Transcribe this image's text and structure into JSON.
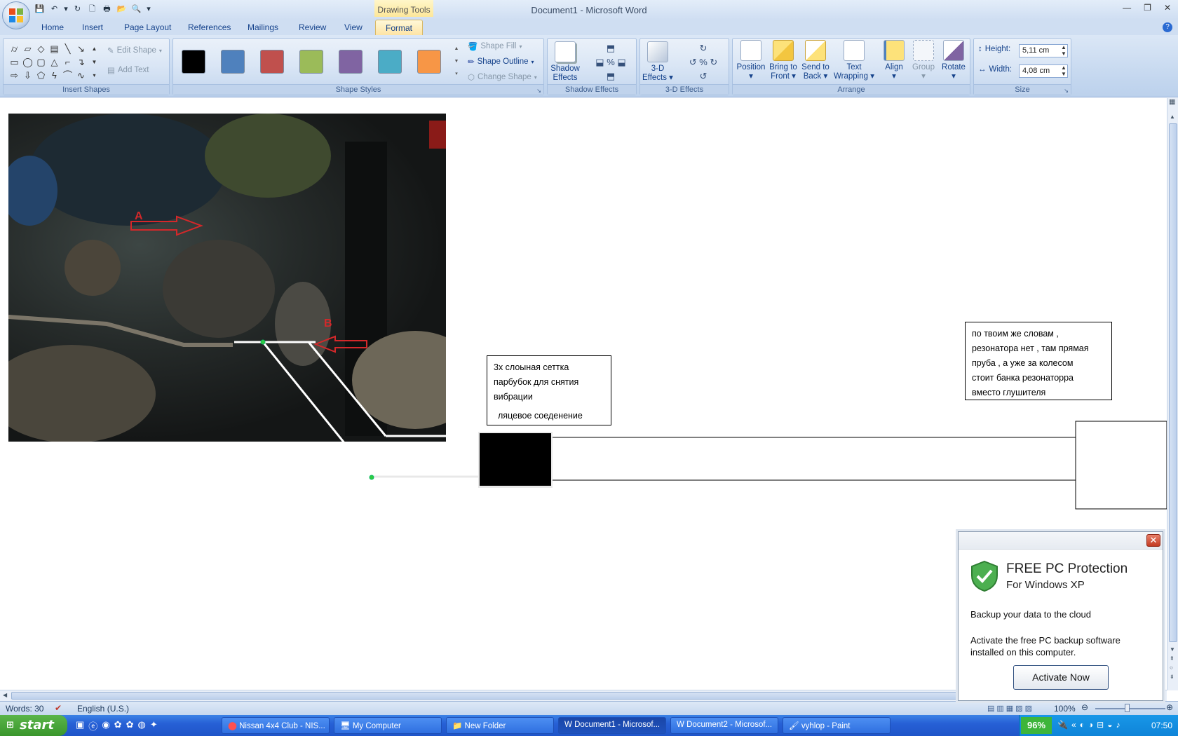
{
  "window": {
    "title": "Document1 - Microsoft Word",
    "contextual_tab_group": "Drawing Tools"
  },
  "tabs": [
    "Home",
    "Insert",
    "Page Layout",
    "References",
    "Mailings",
    "Review",
    "View",
    "Format"
  ],
  "active_tab": "Format",
  "ribbon": {
    "insert_shapes": {
      "label": "Insert Shapes",
      "edit_shape": "Edit Shape",
      "add_text": "Add Text"
    },
    "shape_styles": {
      "label": "Shape Styles",
      "swatches": [
        "#000000",
        "#4f81bd",
        "#c0504d",
        "#9bbb59",
        "#8064a2",
        "#4bacc6",
        "#f79646"
      ],
      "shape_fill": "Shape Fill",
      "shape_outline": "Shape Outline",
      "change_shape": "Change Shape"
    },
    "shadow_effects": {
      "label": "Shadow Effects",
      "button_line1": "Shadow",
      "button_line2": "Effects"
    },
    "effects_3d": {
      "label": "3-D Effects",
      "button_line1": "3-D",
      "button_line2": "Effects"
    },
    "arrange": {
      "label": "Arrange",
      "position": "Position",
      "bring_front_1": "Bring to",
      "bring_front_2": "Front",
      "send_back_1": "Send to",
      "send_back_2": "Back",
      "wrap_1": "Text",
      "wrap_2": "Wrapping",
      "align": "Align",
      "group": "Group",
      "rotate": "Rotate"
    },
    "size": {
      "label": "Size",
      "height_label": "Height:",
      "height_value": "5,11 cm",
      "width_label": "Width:",
      "width_value": "4,08 cm"
    }
  },
  "document": {
    "photo_label_a": "A",
    "photo_label_b": "B",
    "textbox1": {
      "line1": "3х слоыная  сеттка",
      "line2": "парбубок  для  снятия",
      "line3": "вибрации",
      "line4": "ляцевое  соеденение"
    },
    "textbox2": {
      "line1": "по твоим  же  словам ,",
      "line2": "резонатора нет , там  прямая",
      "line3": "пруба  , а  уже за  колесом",
      "line4": "стоит банка резонаторра",
      "line5": "вместо  глушителя"
    }
  },
  "popup": {
    "title": "FREE PC Protection",
    "subtitle": "For Windows XP",
    "text1": "Backup your data to the cloud",
    "text2": "Activate the free PC backup software installed on this computer.",
    "button": "Activate Now",
    "close": "✕"
  },
  "status": {
    "words": "Words: 30",
    "language": "English (U.S.)",
    "zoom": "100%"
  },
  "taskbar": {
    "start": "start",
    "items": [
      "Nissan 4x4 Club - NIS...",
      "My Computer",
      "New Folder",
      "Document1 - Microsof...",
      "Document2 - Microsof...",
      "vyhlop - Paint"
    ],
    "battery": "96%",
    "clock": "07:50"
  }
}
